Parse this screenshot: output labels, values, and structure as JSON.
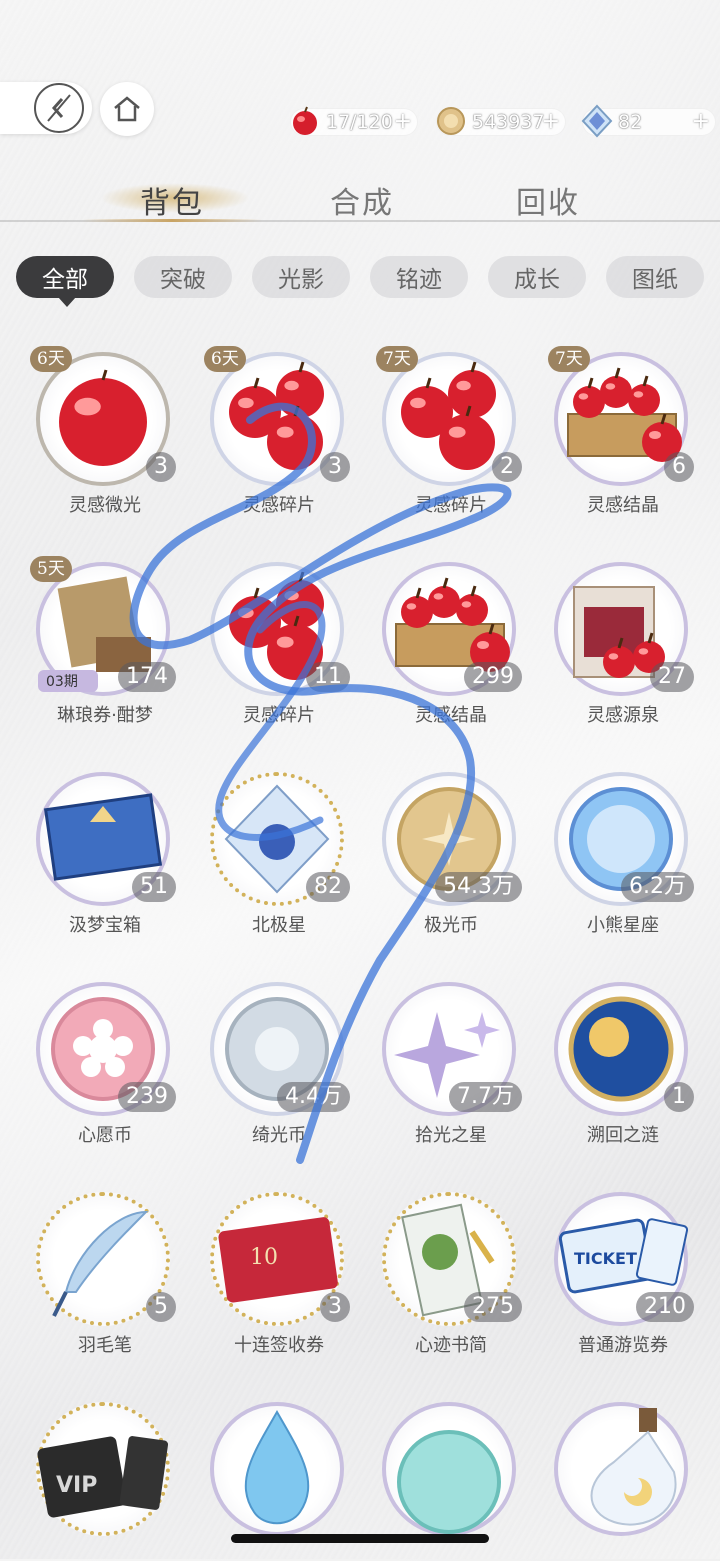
{
  "header": {
    "currencies": [
      {
        "icon": "apple-icon",
        "value": "17/120",
        "plus": "+"
      },
      {
        "icon": "coin-icon",
        "value": "543937",
        "plus": "+"
      },
      {
        "icon": "diamond-icon",
        "value": "82",
        "plus": "+"
      }
    ]
  },
  "main_tabs": [
    {
      "label": "背包",
      "active": true
    },
    {
      "label": "合成",
      "active": false
    },
    {
      "label": "回收",
      "active": false
    }
  ],
  "filters": [
    "全部",
    "突破",
    "光影",
    "铭迹",
    "成长",
    "图纸"
  ],
  "items": [
    {
      "name": "灵感微光",
      "count": "3",
      "days": "6天",
      "icon": "single-apple-icon"
    },
    {
      "name": "灵感碎片",
      "count": "3",
      "days": "6天",
      "icon": "three-apples-icon"
    },
    {
      "name": "灵感碎片",
      "count": "2",
      "days": "7天",
      "icon": "three-apples-icon"
    },
    {
      "name": "灵感结晶",
      "count": "6",
      "days": "7天",
      "icon": "apple-basket-icon"
    },
    {
      "name": "琳琅券·酣梦",
      "count": "174",
      "days": "5天",
      "icon": "ticket-stack-icon",
      "badge": "03期"
    },
    {
      "name": "灵感碎片",
      "count": "11",
      "days": "",
      "icon": "three-apples-icon"
    },
    {
      "name": "灵感结晶",
      "count": "299",
      "days": "",
      "icon": "apple-basket-icon"
    },
    {
      "name": "灵感源泉",
      "count": "27",
      "days": "",
      "icon": "apple-box-icon"
    },
    {
      "name": "汲梦宝箱",
      "count": "51",
      "days": "",
      "icon": "blue-chest-icon"
    },
    {
      "name": "北极星",
      "count": "82",
      "days": "",
      "icon": "crystal-diamond-icon"
    },
    {
      "name": "极光币",
      "count": "54.3万",
      "days": "",
      "icon": "gold-coin-icon"
    },
    {
      "name": "小熊星座",
      "count": "6.2万",
      "days": "",
      "icon": "blue-coin-icon"
    },
    {
      "name": "心愿币",
      "count": "239",
      "days": "",
      "icon": "pink-flower-coin-icon"
    },
    {
      "name": "绮光币",
      "count": "4.4万",
      "days": "",
      "icon": "silver-coin-icon"
    },
    {
      "name": "拾光之星",
      "count": "7.7万",
      "days": "",
      "icon": "purple-star-icon"
    },
    {
      "name": "溯回之涟",
      "count": "1",
      "days": "",
      "icon": "sun-moon-coin-icon"
    },
    {
      "name": "羽毛笔",
      "count": "5",
      "days": "",
      "icon": "quill-pen-icon"
    },
    {
      "name": "十连签收券",
      "count": "3",
      "days": "",
      "icon": "red-card-icon"
    },
    {
      "name": "心迹书简",
      "count": "275",
      "days": "",
      "icon": "plant-card-icon"
    },
    {
      "name": "普通游览券",
      "count": "210",
      "days": "",
      "icon": "ticket-icon"
    },
    {
      "name": "",
      "count": "",
      "days": "",
      "icon": "vip-ticket-icon"
    },
    {
      "name": "",
      "count": "",
      "days": "",
      "icon": "water-drop-icon"
    },
    {
      "name": "",
      "count": "",
      "days": "",
      "icon": "teal-coin-icon"
    },
    {
      "name": "",
      "count": "",
      "days": "",
      "icon": "moon-bottle-icon"
    }
  ],
  "colors": {
    "accent_gold": "#c9a464",
    "chip_active": "#3b3b3d",
    "days_badge": "#9c8360",
    "scribble": "#3b74d8"
  }
}
